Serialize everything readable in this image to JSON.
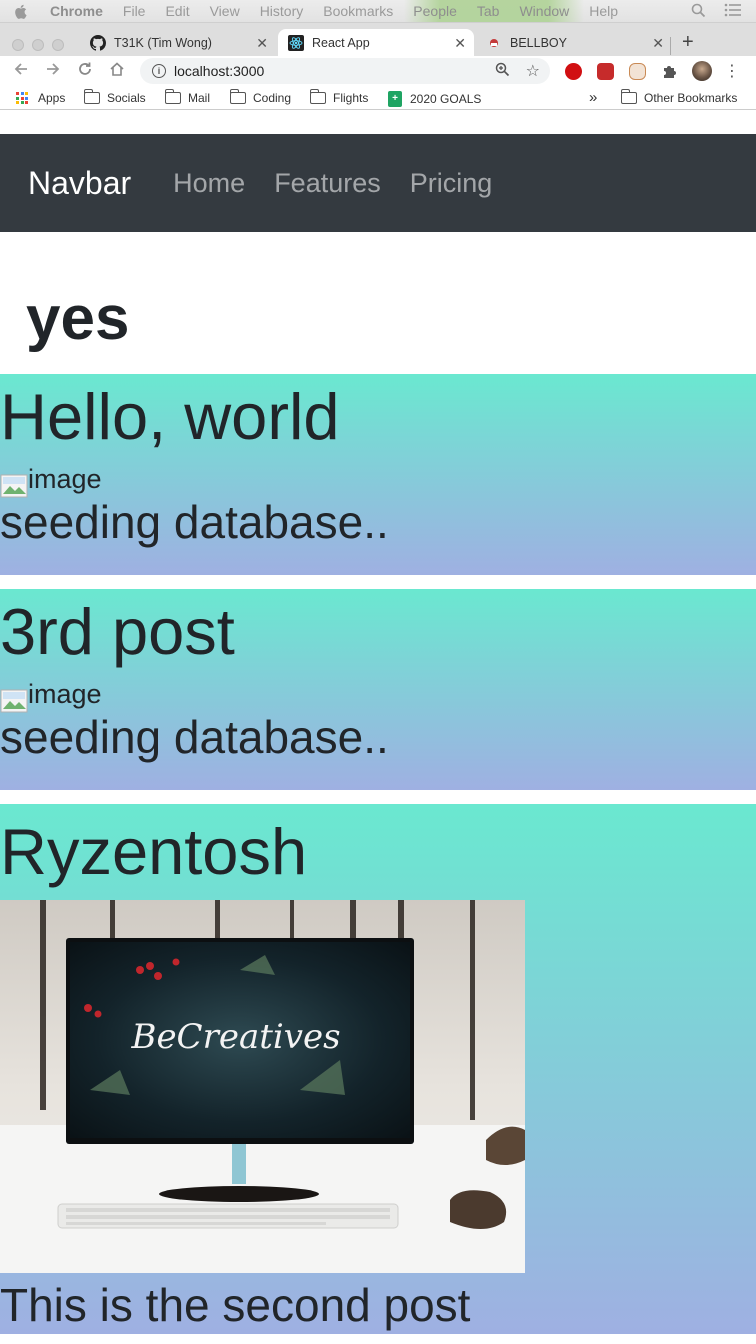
{
  "menubar": {
    "items": [
      "Chrome",
      "File",
      "Edit",
      "View",
      "History",
      "Bookmarks",
      "People",
      "Tab",
      "Window",
      "Help"
    ]
  },
  "tabs": [
    {
      "title": "T31K (Tim Wong)",
      "icon": "github-icon"
    },
    {
      "title": "React App",
      "icon": "react-icon"
    },
    {
      "title": "BELLBOY",
      "icon": "bellboy-icon"
    }
  ],
  "address": {
    "url": "localhost:3000"
  },
  "bookmarks": {
    "apps": "Apps",
    "items": [
      "Socials",
      "Mail",
      "Coding",
      "Flights",
      "2020 GOALS"
    ],
    "overflow": "»",
    "other": "Other Bookmarks"
  },
  "navbar": {
    "brand": "Navbar",
    "links": [
      "Home",
      "Features",
      "Pricing"
    ]
  },
  "page": {
    "heading": "yes"
  },
  "posts": [
    {
      "title": "Hello, world",
      "image_alt": "image",
      "body": "seeding database.."
    },
    {
      "title": "3rd post",
      "image_alt": "image",
      "body": "seeding database.."
    },
    {
      "title": "Ryzentosh",
      "image_text": "BeCreatives",
      "body": "This is the second post"
    }
  ],
  "colors": {
    "navbar_bg": "#343a40",
    "gradient_top": "#6ae8d0",
    "gradient_bottom": "#9fb0e2"
  }
}
